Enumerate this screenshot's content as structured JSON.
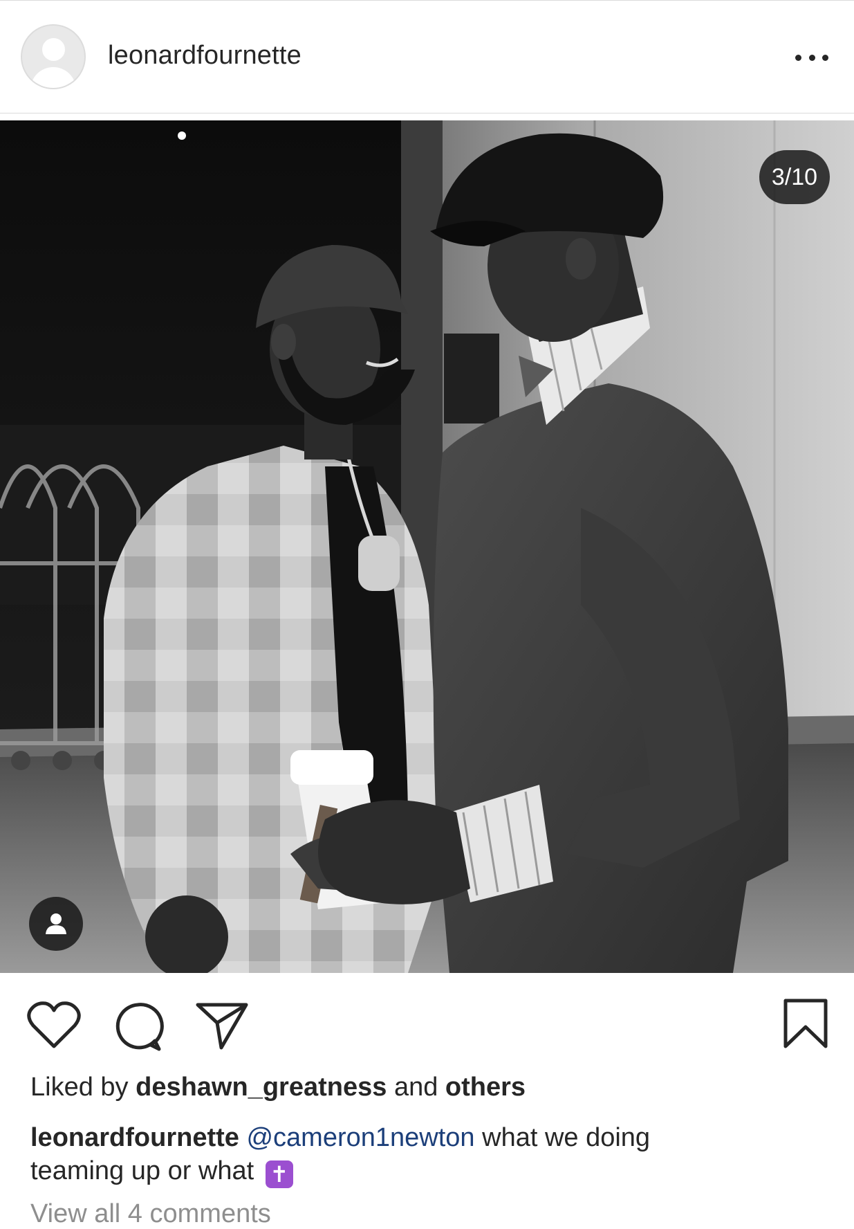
{
  "post": {
    "username": "leonardfournette",
    "more_icon": "more-horizontal-icon",
    "photo_counter": "3/10",
    "photo_description_icon": "person-tag-icon"
  },
  "actions": {
    "like_icon": "heart-icon",
    "comment_icon": "comment-icon",
    "share_icon": "paper-plane-icon",
    "save_icon": "bookmark-icon"
  },
  "likes": {
    "prefix": "Liked by",
    "user": "deshawn_greatness",
    "connector": "and",
    "others": "others"
  },
  "caption": {
    "username": "leonardfournette",
    "mention": "@cameron1newton",
    "text_line1": "what we doing",
    "text_line2": "teaming up or what",
    "emoji": "✝"
  },
  "comments_link": "View all 4 comments",
  "colors": {
    "text": "#262626",
    "mention": "#1c3f7a",
    "muted": "#8e8e8e",
    "divider": "#dbdbdb",
    "emoji_bg": "#9b4fd0"
  }
}
